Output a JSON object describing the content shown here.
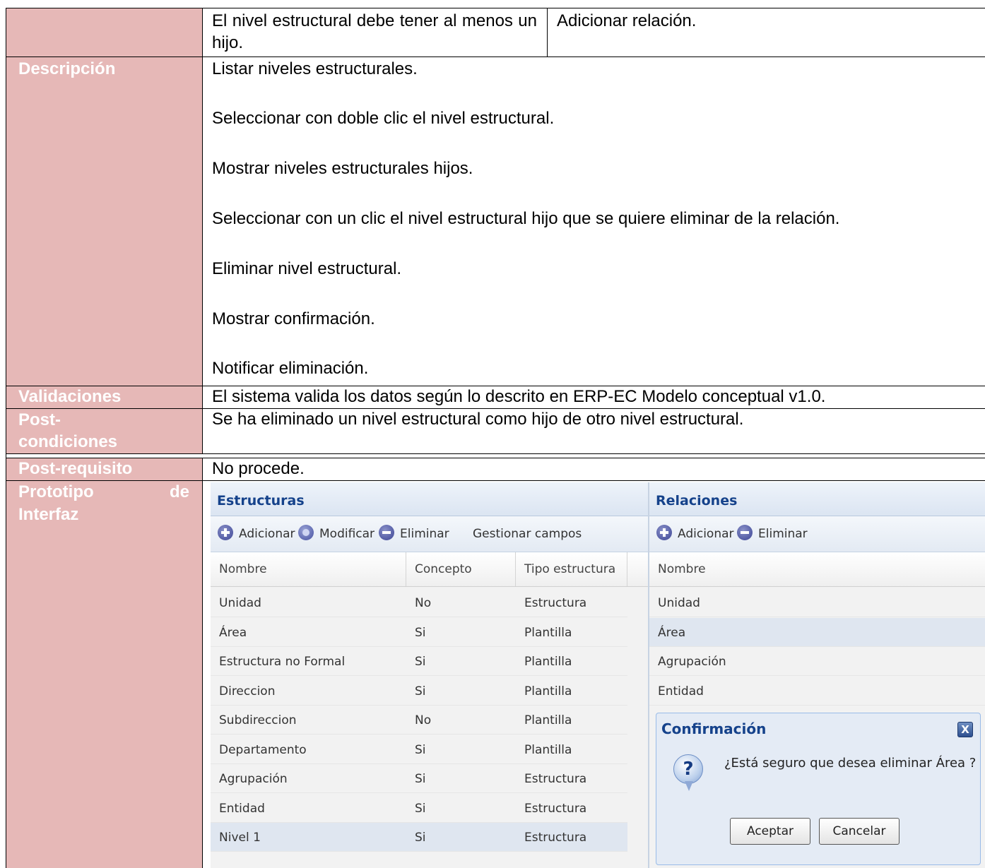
{
  "top_row": {
    "left_text": "El nivel estructural debe tener al menos un hijo.",
    "right_text": "Adicionar relación."
  },
  "sections": {
    "descripcion": {
      "label": "Descripción",
      "steps": [
        "Listar niveles estructurales.",
        "Seleccionar con doble clic el nivel estructural.",
        "Mostrar niveles estructurales hijos.",
        "Seleccionar con un clic el nivel estructural hijo que se quiere eliminar de la relación.",
        "Eliminar nivel estructural.",
        "Mostrar confirmación.",
        "Notificar eliminación."
      ]
    },
    "validaciones": {
      "label": "Validaciones",
      "text": "El sistema valida los datos según lo descrito en ERP-EC Modelo conceptual v1.0."
    },
    "post_condiciones": {
      "label_line1": "Post-",
      "label_line2": "condiciones",
      "text": "Se ha eliminado un nivel estructural como hijo de otro nivel estructural."
    },
    "post_requisito": {
      "label": "Post-requisito",
      "text": "No procede."
    },
    "prototipo": {
      "label_line1_a": "Prototipo",
      "label_line1_b": "de",
      "label_line2": "Interfaz"
    }
  },
  "colors": {
    "label_bg": "#e6b8b7",
    "label_text": "#ffffff",
    "panel_title": "#15428b"
  },
  "prototype": {
    "estructuras": {
      "title": "Estructuras",
      "toolbar": {
        "add": "Adicionar",
        "modify": "Modificar",
        "delete": "Eliminar",
        "manage_fields": "Gestionar campos"
      },
      "columns": [
        "Nombre",
        "Concepto",
        "Tipo estructura"
      ],
      "rows": [
        [
          "Unidad",
          "No",
          "Estructura"
        ],
        [
          "Área",
          "Si",
          "Plantilla"
        ],
        [
          "Estructura no Formal",
          "Si",
          "Plantilla"
        ],
        [
          "Direccion",
          "Si",
          "Plantilla"
        ],
        [
          "Subdireccion",
          "No",
          "Plantilla"
        ],
        [
          "Departamento",
          "Si",
          "Plantilla"
        ],
        [
          "Agrupación",
          "Si",
          "Estructura"
        ],
        [
          "Entidad",
          "Si",
          "Estructura"
        ],
        [
          "Nivel 1",
          "Si",
          "Estructura"
        ]
      ],
      "selected_row": "Nivel 1"
    },
    "relaciones": {
      "title": "Relaciones",
      "toolbar": {
        "add": "Adicionar",
        "delete": "Eliminar"
      },
      "columns": [
        "Nombre"
      ],
      "rows": [
        "Unidad",
        "Área",
        "Agrupación",
        "Entidad"
      ],
      "selected_row": "Área"
    },
    "confirm_dialog": {
      "title": "Confirmación",
      "close_icon": "X",
      "question_icon": "?",
      "message": "¿Está seguro que desea eliminar Área ?",
      "accept": "Aceptar",
      "cancel": "Cancelar"
    }
  }
}
